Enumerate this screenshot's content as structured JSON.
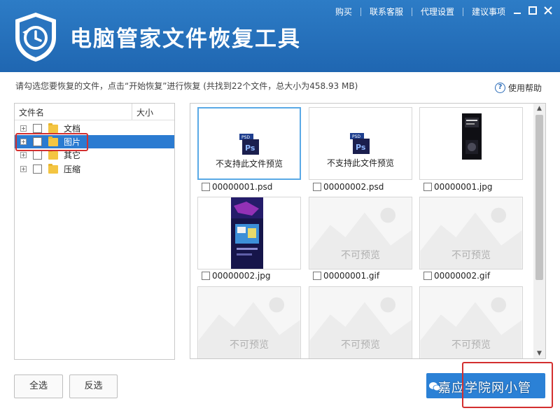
{
  "titlebar": {
    "title": "电脑管家文件恢复工具",
    "menu": [
      "购买",
      "联系客服",
      "代理设置",
      "建议事项"
    ],
    "window_buttons": [
      "minimize-icon",
      "maximize-icon",
      "close-icon"
    ]
  },
  "info": {
    "text": "请勾选您要恢复的文件，点击“开始恢复”进行恢复 (共找到22个文件，总大小为458.93 MB)",
    "help_label": "使用帮助"
  },
  "tree": {
    "columns": [
      "文件名",
      "大小"
    ],
    "items": [
      {
        "label": "文档",
        "selected": false
      },
      {
        "label": "图片",
        "selected": true
      },
      {
        "label": "其它",
        "selected": false
      },
      {
        "label": "压缩",
        "selected": false
      }
    ]
  },
  "files": [
    {
      "name": "00000001.psd",
      "preview": "ps-icon",
      "preview_text": "不支持此文件预览"
    },
    {
      "name": "00000002.psd",
      "preview": "ps-icon",
      "preview_text": "不支持此文件预览"
    },
    {
      "name": "00000001.jpg",
      "preview": "image"
    },
    {
      "name": "00000002.jpg",
      "preview": "image"
    },
    {
      "name": "00000001.gif",
      "preview": "placeholder",
      "preview_text": "不可预览"
    },
    {
      "name": "00000002.gif",
      "preview": "placeholder",
      "preview_text": "不可预览"
    },
    {
      "name": "",
      "preview": "placeholder",
      "preview_text": "不可预览"
    },
    {
      "name": "",
      "preview": "placeholder",
      "preview_text": "不可预览"
    },
    {
      "name": "",
      "preview": "placeholder",
      "preview_text": "不可预览"
    }
  ],
  "bottom": {
    "select_all": "全选",
    "invert_selection": "反选",
    "watermark": "嘉应学院网小管"
  },
  "colors": {
    "titlebar": "#2570bb",
    "selection": "#2b7bd1",
    "highlight": "#d32f2f",
    "primary_button": "#2b81d6"
  }
}
